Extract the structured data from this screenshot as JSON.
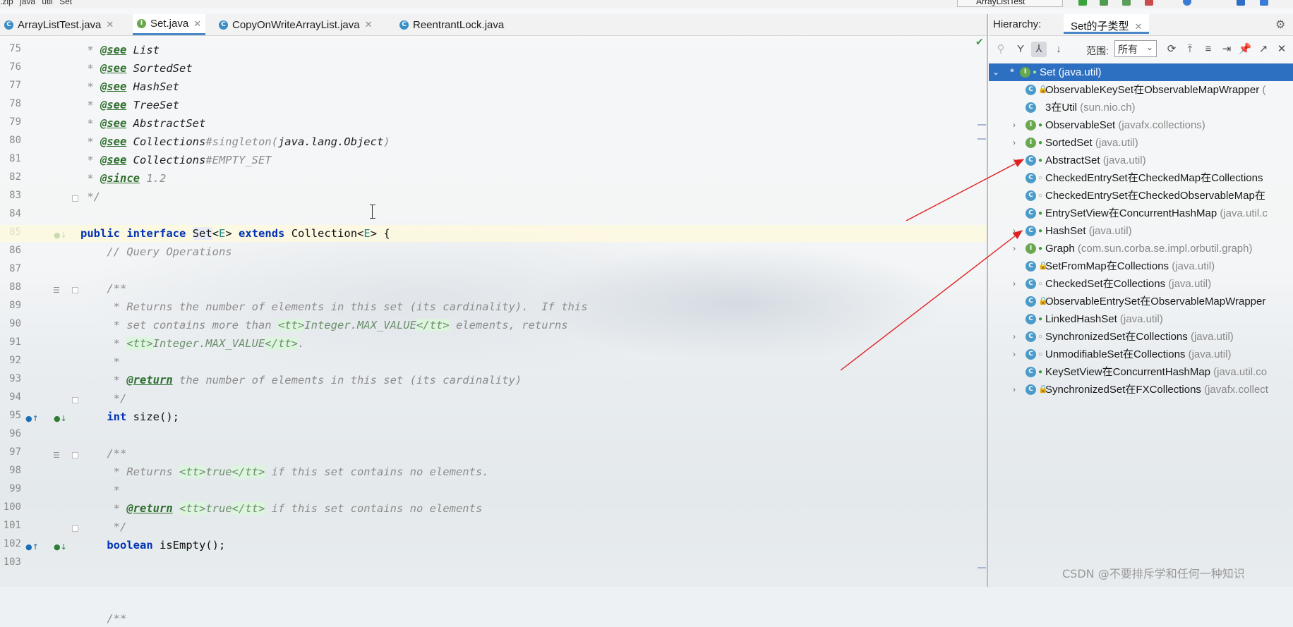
{
  "topbar": {
    "crumbs": [
      ".zip",
      "java",
      "util",
      "Set"
    ],
    "run_config": "ArrayListTest"
  },
  "editor_tabs": [
    {
      "label": "ArrayListTest.java",
      "kind": "class",
      "active": false
    },
    {
      "label": "Set.java",
      "kind": "interface",
      "active": true
    },
    {
      "label": "CopyOnWriteArrayList.java",
      "kind": "class",
      "active": false
    },
    {
      "label": "ReentrantLock.java",
      "kind": "class",
      "active": false
    }
  ],
  "editor": {
    "line_numbers": [
      "75",
      "76",
      "77",
      "78",
      "79",
      "80",
      "81",
      "82",
      "83",
      "84",
      "85",
      "86",
      "87",
      "88",
      "89",
      "90",
      "91",
      "92",
      "93",
      "94",
      "95",
      "96",
      "97",
      "98",
      "99",
      "100",
      "101",
      "102",
      "103"
    ],
    "lines": {
      "l75": {
        "star": " * ",
        "tag": "@see",
        "ref": " List"
      },
      "l76": {
        "star": " * ",
        "tag": "@see",
        "ref": " SortedSet"
      },
      "l77": {
        "star": " * ",
        "tag": "@see",
        "ref": " HashSet"
      },
      "l78": {
        "star": " * ",
        "tag": "@see",
        "ref": " TreeSet"
      },
      "l79": {
        "star": " * ",
        "tag": "@see",
        "ref": " AbstractSet"
      },
      "l80": {
        "star": " * ",
        "tag": "@see",
        "ref": " Collections",
        "rest": "#singleton(",
        "ref2": "java.lang.Object",
        "end": ")"
      },
      "l81": {
        "star": " * ",
        "tag": "@see",
        "ref": " Collections",
        "rest": "#EMPTY_SET"
      },
      "l82": {
        "star": " * ",
        "tag": "@since",
        "rest": " 1.2"
      },
      "l83": {
        "text": " */"
      },
      "l85": {
        "kw1": "public",
        "kw2": "interface",
        "name": "Set",
        "gen1": "E",
        "kw3": "extends",
        "base": "Collection",
        "gen2": "E",
        "end": " {"
      },
      "l86": {
        "text": "    // Query Operations"
      },
      "l88": {
        "text": "    /**"
      },
      "l89": {
        "text": "     * Returns the number of elements in this set (its cardinality).  If this"
      },
      "l90": {
        "a": "     * set contains more than ",
        "tt1": "<tt>",
        "mid": "Integer.MAX_VALUE",
        "tt2": "</tt>",
        "b": " elements, returns"
      },
      "l91": {
        "a": "     * ",
        "tt1": "<tt>",
        "mid": "Integer.MAX_VALUE",
        "tt2": "</tt>",
        "b": "."
      },
      "l92": {
        "text": "     *"
      },
      "l93": {
        "a": "     * ",
        "tag": "@return",
        "b": " the number of elements in this set (its cardinality)"
      },
      "l94": {
        "text": "     */"
      },
      "l95": {
        "kw": "    int",
        "rest": " size();"
      },
      "l97": {
        "text": "    /**"
      },
      "l98": {
        "a": "     * Returns ",
        "tt1": "<tt>",
        "mid": "true",
        "tt2": "</tt>",
        "b": " if this set contains no elements."
      },
      "l99": {
        "text": "     *"
      },
      "l100": {
        "a": "     * ",
        "tag": "@return",
        "b": " ",
        "tt1": "<tt>",
        "mid": "true",
        "tt2": "</tt>",
        "c": " if this set contains no elements"
      },
      "l101": {
        "text": "     */"
      },
      "l102": {
        "kw": "    boolean",
        "rest": " isEmpty();"
      },
      "l104": {
        "text": "    /**"
      }
    }
  },
  "hierarchy": {
    "label": "Hierarchy:",
    "tab": "Set的子类型",
    "scope_label": "范围:",
    "scope_value": "所有",
    "items": [
      {
        "name": "Set",
        "pkg": " (java.util)",
        "kind": "interface",
        "selected": true,
        "expand": "open",
        "prefix": "* "
      },
      {
        "name": "ObservableKeySet在ObservableMapWrapper",
        "pkg": " (",
        "kind": "class",
        "vis": "lock"
      },
      {
        "name": "3在Util",
        "pkg": " (sun.nio.ch)",
        "kind": "class",
        "vis": "none"
      },
      {
        "name": "ObservableSet",
        "pkg": " (javafx.collections)",
        "kind": "interface",
        "vis": "pub",
        "expand": "closed"
      },
      {
        "name": "SortedSet",
        "pkg": " (java.util)",
        "kind": "interface",
        "vis": "pub",
        "expand": "closed"
      },
      {
        "name": "AbstractSet",
        "pkg": " (java.util)",
        "kind": "class",
        "vis": "pub",
        "expand": "closed"
      },
      {
        "name": "CheckedEntrySet在CheckedMap在Collections",
        "pkg": "",
        "kind": "class",
        "vis": "pkg"
      },
      {
        "name": "CheckedEntrySet在CheckedObservableMap在",
        "pkg": "",
        "kind": "class",
        "vis": "pkg"
      },
      {
        "name": "EntrySetView在ConcurrentHashMap",
        "pkg": " (java.util.c",
        "kind": "class",
        "vis": "pub"
      },
      {
        "name": "HashSet",
        "pkg": " (java.util)",
        "kind": "class",
        "vis": "pub",
        "expand": "closed"
      },
      {
        "name": "Graph",
        "pkg": " (com.sun.corba.se.impl.orbutil.graph)",
        "kind": "interface",
        "vis": "pub",
        "expand": "closed"
      },
      {
        "name": "SetFromMap在Collections",
        "pkg": " (java.util)",
        "kind": "class",
        "vis": "lock"
      },
      {
        "name": "CheckedSet在Collections",
        "pkg": " (java.util)",
        "kind": "class",
        "vis": "pkg",
        "expand": "closed"
      },
      {
        "name": "ObservableEntrySet在ObservableMapWrapper",
        "pkg": "",
        "kind": "class",
        "vis": "lock"
      },
      {
        "name": "LinkedHashSet",
        "pkg": " (java.util)",
        "kind": "class",
        "vis": "pub"
      },
      {
        "name": "SynchronizedSet在Collections",
        "pkg": " (java.util)",
        "kind": "class",
        "vis": "pkg",
        "expand": "closed"
      },
      {
        "name": "UnmodifiableSet在Collections",
        "pkg": " (java.util)",
        "kind": "class",
        "vis": "pkg",
        "expand": "closed"
      },
      {
        "name": "KeySetView在ConcurrentHashMap",
        "pkg": " (java.util.co",
        "kind": "class",
        "vis": "pub"
      },
      {
        "name": "SynchronizedSet在FXCollections",
        "pkg": " (javafx.collect",
        "kind": "class",
        "vis": "lock",
        "expand": "closed"
      }
    ]
  },
  "watermark": "CSDN @不要排斥学和任何一种知识",
  "colors": {
    "selection": "#2d6fc0",
    "annotation_arrow": "#e02020",
    "keyword": "#0033b3"
  }
}
